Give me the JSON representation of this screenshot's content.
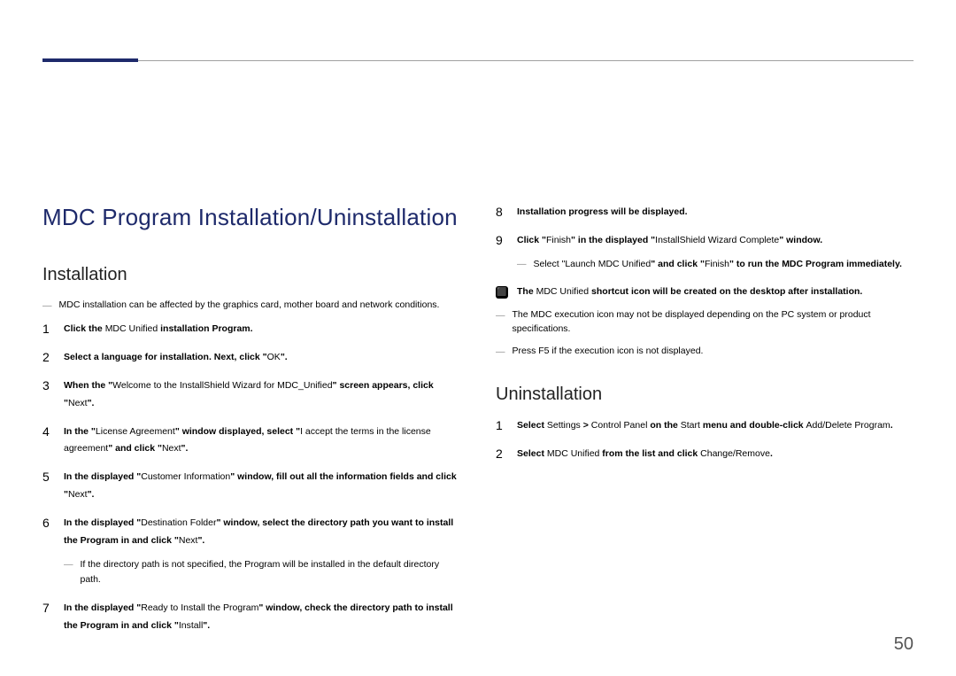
{
  "pageNumber": "50",
  "mainTitle": "MDC Program Installation/Uninstallation",
  "installation": {
    "heading": "Installation",
    "note": "MDC installation can be affected by the graphics card, mother board and network conditions.",
    "steps": [
      {
        "num": "1",
        "parts": [
          {
            "t": "Click the ",
            "b": true
          },
          {
            "t": "MDC Unified",
            "b": false
          },
          {
            "t": " installation Program.",
            "b": true
          }
        ]
      },
      {
        "num": "2",
        "parts": [
          {
            "t": "Select a language for installation. Next, click \"",
            "b": true
          },
          {
            "t": "OK",
            "b": false
          },
          {
            "t": "\".",
            "b": true
          }
        ]
      },
      {
        "num": "3",
        "parts": [
          {
            "t": "When the \"",
            "b": true
          },
          {
            "t": "Welcome to the InstallShield Wizard for MDC_Unified",
            "b": false
          },
          {
            "t": "\" screen appears, click \"",
            "b": true
          },
          {
            "t": "Next",
            "b": false
          },
          {
            "t": "\".",
            "b": true
          }
        ]
      },
      {
        "num": "4",
        "parts": [
          {
            "t": "In the \"",
            "b": true
          },
          {
            "t": "License Agreement",
            "b": false
          },
          {
            "t": "\" window displayed, select \"",
            "b": true
          },
          {
            "t": "I accept the terms in the license agreement",
            "b": false
          },
          {
            "t": "\" and click \"",
            "b": true
          },
          {
            "t": "Next",
            "b": false
          },
          {
            "t": "\".",
            "b": true
          }
        ]
      },
      {
        "num": "5",
        "parts": [
          {
            "t": "In the displayed \"",
            "b": true
          },
          {
            "t": "Customer Information",
            "b": false
          },
          {
            "t": "\" window, fill out all the information fields and click \"",
            "b": true
          },
          {
            "t": "Next",
            "b": false
          },
          {
            "t": "\".",
            "b": true
          }
        ]
      },
      {
        "num": "6",
        "parts": [
          {
            "t": "In the displayed \"",
            "b": true
          },
          {
            "t": "Destination Folder",
            "b": false
          },
          {
            "t": "\" window, select the directory path you want to install the Program in and click \"",
            "b": true
          },
          {
            "t": "Next",
            "b": false
          },
          {
            "t": "\".",
            "b": true
          }
        ],
        "subnote": "If the directory path is not specified, the Program will be installed in the default directory path."
      },
      {
        "num": "7",
        "parts": [
          {
            "t": "In the displayed \"",
            "b": true
          },
          {
            "t": "Ready to Install the Program",
            "b": false
          },
          {
            "t": "\" window, check the directory path to install the Program in and click \"",
            "b": true
          },
          {
            "t": "Install",
            "b": false
          },
          {
            "t": "\".",
            "b": true
          }
        ]
      }
    ]
  },
  "installationRight": {
    "steps": [
      {
        "num": "8",
        "parts": [
          {
            "t": "Installation progress will be displayed.",
            "b": true
          }
        ]
      },
      {
        "num": "9",
        "parts": [
          {
            "t": "Click \"",
            "b": true
          },
          {
            "t": "Finish",
            "b": false
          },
          {
            "t": "\" in the displayed \"",
            "b": true
          },
          {
            "t": "InstallShield Wizard Complete",
            "b": false
          },
          {
            "t": "\" window.",
            "b": true
          }
        ],
        "subnotes": [
          [
            {
              "t": "Select \"",
              "b": false
            },
            {
              "t": "Launch MDC Unified",
              "b": false
            },
            {
              "t": "\" and click \"",
              "b": true
            },
            {
              "t": "Finish",
              "b": false
            },
            {
              "t": "\" to run the MDC Program immediately.",
              "b": true
            }
          ]
        ]
      }
    ],
    "iconNote": [
      {
        "t": "The ",
        "b": true
      },
      {
        "t": "MDC Unified",
        "b": false
      },
      {
        "t": " shortcut icon will be created on the desktop after installation.",
        "b": true
      }
    ],
    "postNotes": [
      "The MDC execution icon may not be displayed depending on the PC system or product specifications.",
      "Press F5 if the execution icon is not displayed."
    ]
  },
  "uninstallation": {
    "heading": "Uninstallation",
    "steps": [
      {
        "num": "1",
        "parts": [
          {
            "t": "Select ",
            "b": true
          },
          {
            "t": "Settings",
            "b": false
          },
          {
            "t": " > ",
            "b": true
          },
          {
            "t": "Control Panel",
            "b": false
          },
          {
            "t": " on the ",
            "b": true
          },
          {
            "t": "Start",
            "b": false
          },
          {
            "t": " menu and double-click ",
            "b": true
          },
          {
            "t": "Add/Delete Program",
            "b": false
          },
          {
            "t": ".",
            "b": true
          }
        ]
      },
      {
        "num": "2",
        "parts": [
          {
            "t": "Select ",
            "b": true
          },
          {
            "t": "MDC Unified",
            "b": false
          },
          {
            "t": " from the list and click ",
            "b": true
          },
          {
            "t": "Change/Remove",
            "b": false
          },
          {
            "t": ".",
            "b": true
          }
        ]
      }
    ]
  }
}
